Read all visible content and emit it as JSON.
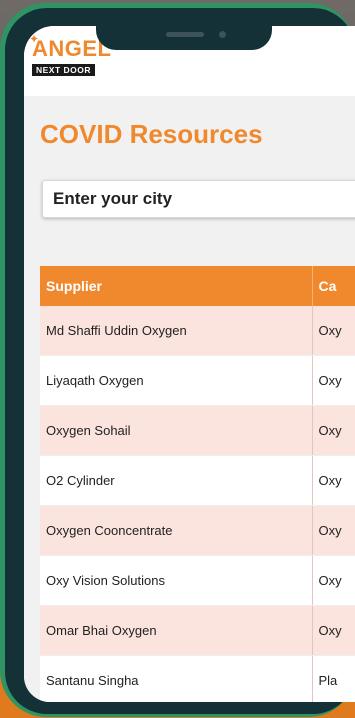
{
  "brand": {
    "logo_text": "ANGEL",
    "logo_subtitle": "NEXT DOOR"
  },
  "page": {
    "title": "COVID Resources"
  },
  "search": {
    "placeholder": "Enter your city"
  },
  "table": {
    "columns": [
      "Supplier",
      "Ca"
    ],
    "rows": [
      {
        "supplier": "Md Shaffi Uddin Oxygen",
        "category": "Oxy"
      },
      {
        "supplier": "Liyaqath Oxygen",
        "category": "Oxy"
      },
      {
        "supplier": "Oxygen Sohail",
        "category": "Oxy"
      },
      {
        "supplier": "O2 Cylinder",
        "category": "Oxy"
      },
      {
        "supplier": "Oxygen Cooncentrate",
        "category": "Oxy"
      },
      {
        "supplier": "Oxy Vision Solutions",
        "category": "Oxy"
      },
      {
        "supplier": "Omar Bhai Oxygen",
        "category": "Oxy"
      },
      {
        "supplier": "Santanu Singha",
        "category": "Pla"
      }
    ]
  },
  "colors": {
    "accent": "#f0892e",
    "row_alt": "#fbe4de",
    "frame": "#2e9463",
    "bezel": "#143137"
  }
}
